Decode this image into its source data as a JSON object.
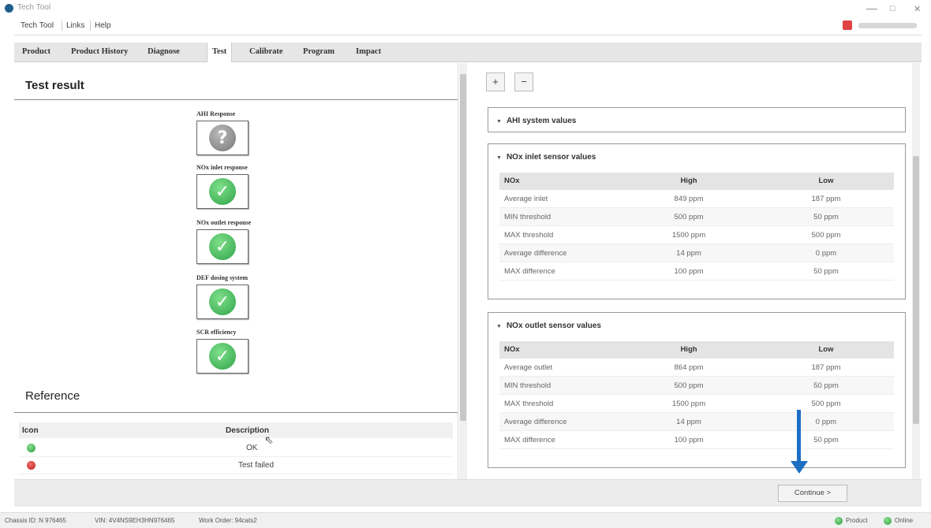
{
  "window": {
    "title": "Tech Tool",
    "minimize": "—",
    "maximize": "□",
    "close": "✕"
  },
  "menu": [
    "Tech Tool",
    "Links",
    "Help"
  ],
  "tabs": [
    "Product",
    "Product History",
    "Diagnose",
    "Test",
    "Calibrate",
    "Program",
    "Impact"
  ],
  "active_tab": "Test",
  "left": {
    "title": "Test result",
    "results": [
      {
        "label": "AHI Response",
        "status": "unknown"
      },
      {
        "label": "NOx inlet response",
        "status": "ok"
      },
      {
        "label": "NOx outlet response",
        "status": "ok"
      },
      {
        "label": "DEF dosing system",
        "status": "ok"
      },
      {
        "label": "SCR efficiency",
        "status": "ok"
      }
    ],
    "reference": {
      "title": "Reference",
      "headers": {
        "icon": "Icon",
        "description": "Description"
      },
      "rows": [
        {
          "icon": "ok",
          "description": "OK"
        },
        {
          "icon": "fail",
          "description": "Test failed"
        }
      ]
    }
  },
  "right": {
    "expand_label": "+",
    "collapse_label": "−",
    "sections": [
      {
        "title": "AHI system values",
        "expanded": false
      },
      {
        "title": "NOx inlet sensor values",
        "expanded": true,
        "headers": [
          "NOx",
          "High",
          "Low"
        ],
        "rows": [
          [
            "Average inlet",
            "849 ppm",
            "187 ppm"
          ],
          [
            "MIN threshold",
            "500 ppm",
            "50 ppm"
          ],
          [
            "MAX threshold",
            "1500 ppm",
            "500 ppm"
          ],
          [
            "Average difference",
            "14 ppm",
            "0 ppm"
          ],
          [
            "MAX difference",
            "100 ppm",
            "50 ppm"
          ]
        ]
      },
      {
        "title": "NOx outlet sensor values",
        "expanded": true,
        "headers": [
          "NOx",
          "High",
          "Low"
        ],
        "rows": [
          [
            "Average outlet",
            "864 ppm",
            "187 ppm"
          ],
          [
            "MIN threshold",
            "500 ppm",
            "50 ppm"
          ],
          [
            "MAX threshold",
            "1500 ppm",
            "500 ppm"
          ],
          [
            "Average difference",
            "14 ppm",
            "0 ppm"
          ],
          [
            "MAX difference",
            "100 ppm",
            "50 ppm"
          ]
        ]
      }
    ]
  },
  "continue_label": "Continue >",
  "status": {
    "chassis": "Chassis ID: N 976465",
    "vin": "VIN: 4V4NS9EH3HN976465",
    "work_order": "Work Order: 94cats2",
    "product": "Product",
    "online": "Online"
  },
  "colors": {
    "accent": "#1d6fc4",
    "ok": "#2fa34a",
    "fail": "#c21d1d"
  }
}
